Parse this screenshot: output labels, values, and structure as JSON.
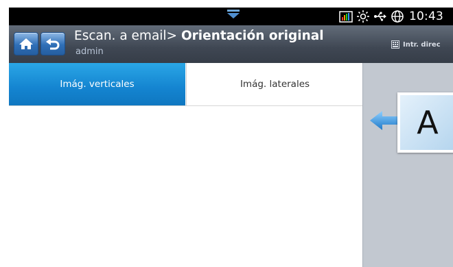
{
  "status_bar": {
    "time": "10:43",
    "icons": [
      "drawer-handle-icon",
      "signal-bars-icon",
      "brightness-icon",
      "usb-icon",
      "globe-icon"
    ]
  },
  "header": {
    "breadcrumb": "Escan. a email>",
    "current": "Orientación original",
    "user": "admin",
    "direct_entry": "Intr. direc",
    "colors": {
      "button": "#2f6fb7",
      "bar": "#3f4753"
    }
  },
  "tabs": [
    {
      "label": "Imág. verticales",
      "selected": true
    },
    {
      "label": "Imág. laterales",
      "selected": false
    }
  ],
  "preview": {
    "letter": "A",
    "arrow_color": "#1e8ee0"
  }
}
